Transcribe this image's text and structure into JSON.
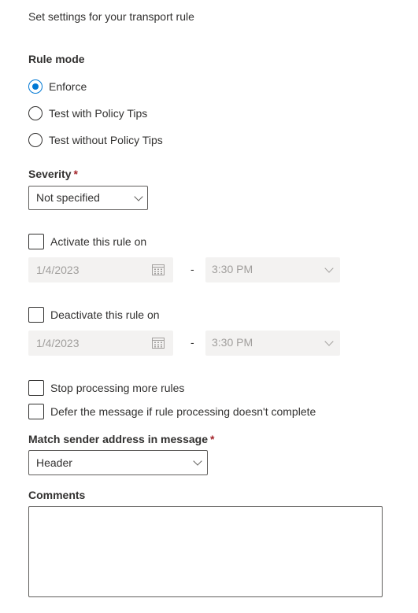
{
  "intro": "Set settings for your transport rule",
  "rule_mode": {
    "label": "Rule mode",
    "options": [
      "Enforce",
      "Test with Policy Tips",
      "Test without Policy Tips"
    ],
    "selected": "Enforce"
  },
  "severity": {
    "label": "Severity",
    "required_mark": "*",
    "value": "Not specified"
  },
  "activate": {
    "label": "Activate this rule on",
    "checked": false,
    "date": "1/4/2023",
    "time": "3:30 PM",
    "separator": "-"
  },
  "deactivate": {
    "label": "Deactivate this rule on",
    "checked": false,
    "date": "1/4/2023",
    "time": "3:30 PM",
    "separator": "-"
  },
  "options": {
    "stop_processing": "Stop processing more rules",
    "defer_message": "Defer the message if rule processing doesn't complete"
  },
  "match_sender": {
    "label": "Match sender address in message",
    "required_mark": "*",
    "value": "Header"
  },
  "comments": {
    "label": "Comments",
    "value": ""
  },
  "colors": {
    "accent": "#0078d4",
    "required": "#a4262c",
    "disabled_bg": "#f3f2f1",
    "disabled_text": "#a19f9d"
  }
}
